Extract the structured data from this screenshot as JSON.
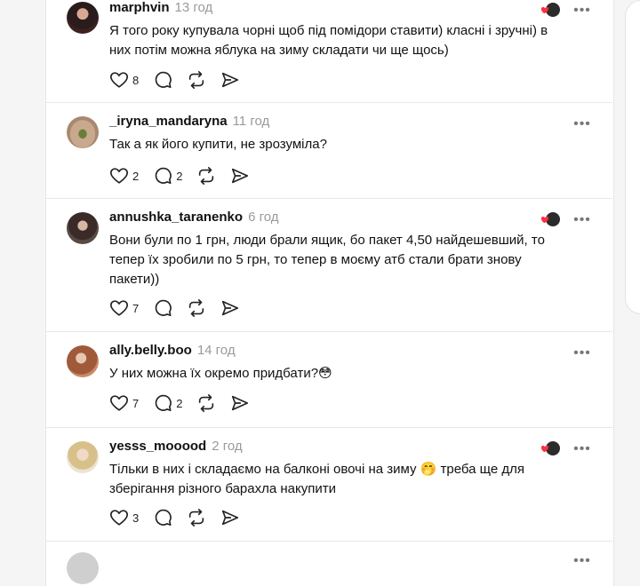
{
  "comments": [
    {
      "username": "marphvin",
      "time": "13 год",
      "text": "Я того року купувала чорні щоб під помідори ставити) класні і зручні) в них потім можна яблука на зиму складати чи ще щось)",
      "likes": "8",
      "replies": "",
      "has_reaction": true
    },
    {
      "username": "_iryna_mandaryna",
      "time": "11 год",
      "text": "Так а як його купити, не зрозуміла?",
      "likes": "2",
      "replies": "2",
      "has_reaction": false
    },
    {
      "username": "annushka_taranenko",
      "time": "6 год",
      "text": "Вони були по 1 грн, люди брали ящик, бо пакет 4,50 найдешевший, то тепер їх зробили по 5 грн, то тепер в моєму атб стали брати знову пакети))",
      "likes": "7",
      "replies": "",
      "has_reaction": true
    },
    {
      "username": "ally.belly.boo",
      "time": "14 год",
      "text": "У них можна їх окремо придбати?😳",
      "likes": "7",
      "replies": "2",
      "has_reaction": false
    },
    {
      "username": "yesss_mooood",
      "time": "2 год",
      "text": "Тільки в них і складаємо на балконі овочі на зиму 🤭 треба ще для зберігання різного барахла накупити",
      "likes": "3",
      "replies": "",
      "has_reaction": true
    }
  ],
  "icons": {
    "like": "heart-icon",
    "reply": "comment-icon",
    "repost": "repost-icon",
    "share": "send-icon",
    "more": "more-options-icon"
  },
  "colors": {
    "text": "#111111",
    "muted": "#9a9a9a",
    "reaction_heart": "#ff3040"
  }
}
